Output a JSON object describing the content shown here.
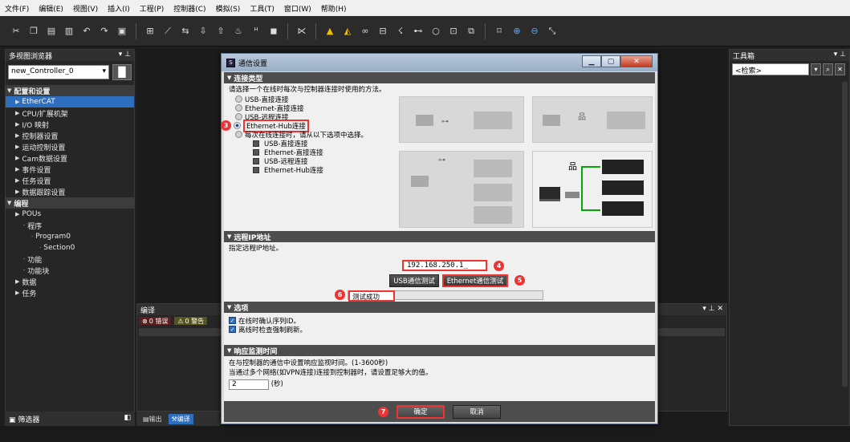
{
  "menu": [
    "文件(F)",
    "编辑(E)",
    "视图(V)",
    "插入(I)",
    "工程(P)",
    "控制器(C)",
    "模拟(S)",
    "工具(T)",
    "窗口(W)",
    "帮助(H)"
  ],
  "left_panel": {
    "title": "多视图浏览器",
    "controller": "new_Controller_0",
    "tree": [
      {
        "label": "配置和设置",
        "indent": 0,
        "section": true
      },
      {
        "label": "EtherCAT",
        "indent": 1,
        "selected": true
      },
      {
        "label": "CPU/扩展机架",
        "indent": 1
      },
      {
        "label": "I/O 映射",
        "indent": 1
      },
      {
        "label": "控制器设置",
        "indent": 1
      },
      {
        "label": "运动控制设置",
        "indent": 1
      },
      {
        "label": "Cam数据设置",
        "indent": 1
      },
      {
        "label": "事件设置",
        "indent": 1
      },
      {
        "label": "任务设置",
        "indent": 1
      },
      {
        "label": "数据跟踪设置",
        "indent": 1
      },
      {
        "label": "编程",
        "indent": 0,
        "section": true
      },
      {
        "label": "POUs",
        "indent": 1
      },
      {
        "label": "程序",
        "indent": 2
      },
      {
        "label": "Program0",
        "indent": 3
      },
      {
        "label": "Section0",
        "indent": 4
      },
      {
        "label": "功能",
        "indent": 2
      },
      {
        "label": "功能块",
        "indent": 2
      },
      {
        "label": "数据",
        "indent": 1
      },
      {
        "label": "任务",
        "indent": 1
      }
    ],
    "filter_label": "筛选器"
  },
  "output": {
    "title": "编译",
    "errors": "0 错误",
    "warnings": "0 警告",
    "tab_output": "输出",
    "tab_compile": "编译"
  },
  "right_panel": {
    "title": "工具箱",
    "search_placeholder": "<检索>"
  },
  "dialog": {
    "title": "通信设置",
    "conn_section": "连接类型",
    "conn_desc": "请选择一个在线时每次与控制器连接时使用的方法。",
    "options": [
      "USB-直接连接",
      "Ethernet-直接连接",
      "USB-远程连接",
      "Ethernet-Hub连接",
      "每次在线连接时，请从以下选项中选择。"
    ],
    "sub_options": [
      "USB-直接连接",
      "Ethernet-直接连接",
      "USB-远程连接",
      "Ethernet-Hub连接"
    ],
    "selected_option": "Ethernet-Hub连接",
    "ip_section": "远程IP地址",
    "ip_desc": "指定远程IP地址。",
    "ip_value": "192.168.250.1_",
    "usb_test": "USB通信测试",
    "eth_test": "Ethernet通信测试",
    "test_result": "测试成功",
    "opt_section": "选项",
    "opt1": "在线时确认序列ID。",
    "opt2": "离线时检查强制刷新。",
    "mon_section": "响应监测时间",
    "mon_desc1": "在与控制器的通信中设置响应监视时间。(1-3600秒)",
    "mon_desc2": "当通过多个网络(如VPN连接)连接到控制器时，请设置足够大的值。",
    "mon_value": "2",
    "mon_unit": "(秒)",
    "ok": "确定",
    "cancel": "取消",
    "badges": [
      "3",
      "4",
      "5",
      "6",
      "7"
    ]
  }
}
